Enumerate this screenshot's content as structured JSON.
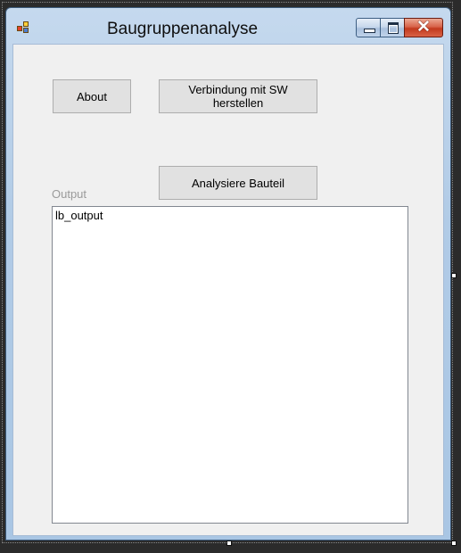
{
  "window": {
    "title": "Baugruppenanalyse",
    "icon": "winforms-app-icon",
    "controls": [
      "minimize-icon",
      "maximize-icon",
      "close-icon"
    ]
  },
  "buttons": {
    "about": "About",
    "connect": "Verbindung mit SW herstellen",
    "analyse": "Analysiere Bauteil"
  },
  "output": {
    "label": "Output",
    "items": [
      "lb_output"
    ]
  },
  "colors": {
    "titlebar": "#b1cbe6",
    "client": "#f0f0f0",
    "close_button": "#c2391d"
  }
}
